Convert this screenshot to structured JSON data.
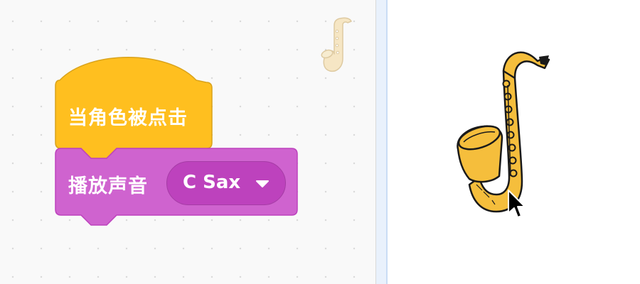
{
  "workspace": {
    "hat_block": {
      "label": "当角色被点击",
      "color": "#FFBF1F",
      "border": "#D9A21A"
    },
    "sound_block": {
      "label": "播放声音",
      "color": "#CF63CF",
      "border": "#BD42BD",
      "sound_dropdown": {
        "value": "C Sax",
        "icon": "triangle-down-icon",
        "color": "#BD42BD"
      }
    },
    "sprite_thumbnail": {
      "icon": "saxophone-icon"
    }
  },
  "stage": {
    "sprite": {
      "icon": "saxophone-icon",
      "color": "#F5BE3C"
    },
    "cursor": {
      "icon": "mouse-pointer-icon"
    }
  }
}
